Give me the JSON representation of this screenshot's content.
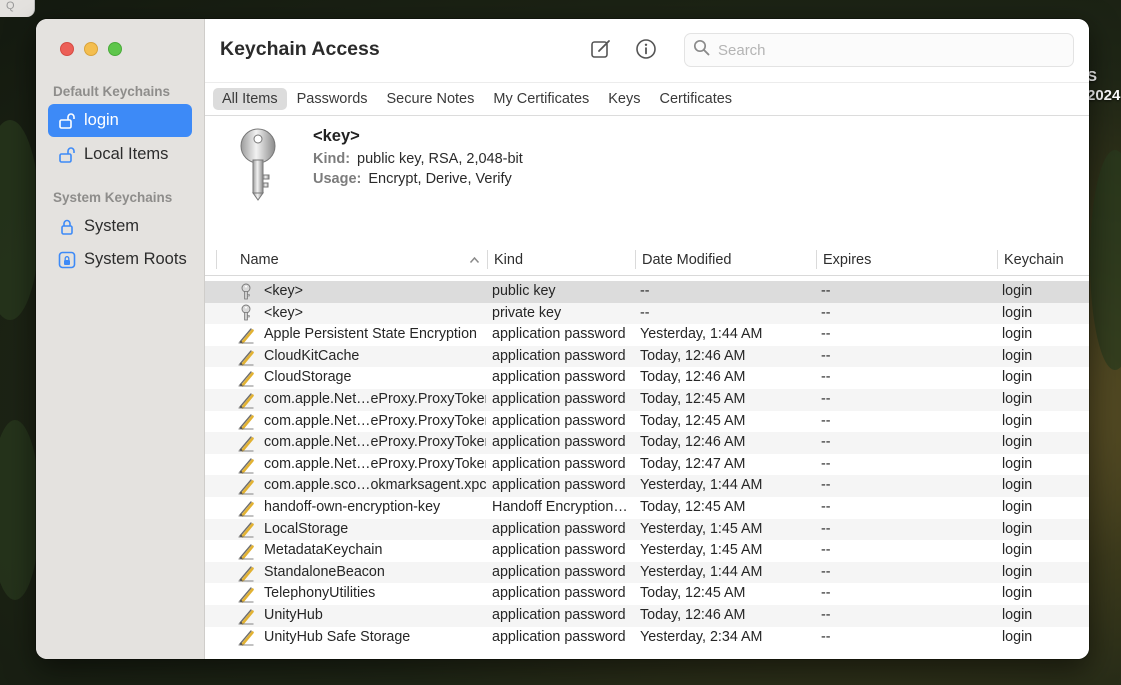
{
  "background": {
    "partial_window_text": "Q",
    "right_text": "S\n2024"
  },
  "window": {
    "app_title": "Keychain Access",
    "search": {
      "placeholder": "Search",
      "value": ""
    },
    "toolbar_icons": [
      "compose-icon",
      "info-icon"
    ]
  },
  "sidebar": {
    "default_section": "Default Keychains",
    "default_items": [
      {
        "label": "login",
        "icon": "unlocked-padlock-icon",
        "selected": true
      },
      {
        "label": "Local Items",
        "icon": "unlocked-padlock-icon",
        "selected": false
      }
    ],
    "system_section": "System Keychains",
    "system_items": [
      {
        "label": "System",
        "icon": "locked-padlock-icon",
        "selected": false
      },
      {
        "label": "System Roots",
        "icon": "cabinet-lock-icon",
        "selected": false
      }
    ]
  },
  "tabs": [
    {
      "label": "All Items",
      "active": true
    },
    {
      "label": "Passwords",
      "active": false
    },
    {
      "label": "Secure Notes",
      "active": false
    },
    {
      "label": "My Certificates",
      "active": false
    },
    {
      "label": "Keys",
      "active": false
    },
    {
      "label": "Certificates",
      "active": false
    }
  ],
  "detail": {
    "name": "<key>",
    "kind_label": "Kind:",
    "kind_value": "public key, RSA, 2,048-bit",
    "usage_label": "Usage:",
    "usage_value": "Encrypt, Derive, Verify"
  },
  "table": {
    "columns": {
      "name": "Name",
      "kind": "Kind",
      "date_modified": "Date Modified",
      "expires": "Expires",
      "keychain": "Keychain"
    },
    "sort_indicator": "chevron-up-icon",
    "rows": [
      {
        "icon": "key-icon",
        "name": "<key>",
        "kind": "public key",
        "date": "--",
        "expires": "--",
        "keychain": "login",
        "selected": true
      },
      {
        "icon": "key-icon",
        "name": "<key>",
        "kind": "private key",
        "date": "--",
        "expires": "--",
        "keychain": "login"
      },
      {
        "icon": "pencil-icon",
        "name": "Apple Persistent State Encryption",
        "kind": "application password",
        "date": "Yesterday, 1:44 AM",
        "expires": "--",
        "keychain": "login"
      },
      {
        "icon": "pencil-icon",
        "name": "CloudKitCache",
        "kind": "application password",
        "date": "Today, 12:46 AM",
        "expires": "--",
        "keychain": "login"
      },
      {
        "icon": "pencil-icon",
        "name": "CloudStorage",
        "kind": "application password",
        "date": "Today, 12:46 AM",
        "expires": "--",
        "keychain": "login"
      },
      {
        "icon": "pencil-icon",
        "name": "com.apple.Net…eProxy.ProxyToken",
        "kind": "application password",
        "date": "Today, 12:45 AM",
        "expires": "--",
        "keychain": "login"
      },
      {
        "icon": "pencil-icon",
        "name": "com.apple.Net…eProxy.ProxyToken",
        "kind": "application password",
        "date": "Today, 12:45 AM",
        "expires": "--",
        "keychain": "login"
      },
      {
        "icon": "pencil-icon",
        "name": "com.apple.Net…eProxy.ProxyToken",
        "kind": "application password",
        "date": "Today, 12:46 AM",
        "expires": "--",
        "keychain": "login"
      },
      {
        "icon": "pencil-icon",
        "name": "com.apple.Net…eProxy.ProxyToken",
        "kind": "application password",
        "date": "Today, 12:47 AM",
        "expires": "--",
        "keychain": "login"
      },
      {
        "icon": "pencil-icon",
        "name": "com.apple.sco…okmarksagent.xpc",
        "kind": "application password",
        "date": "Yesterday, 1:44 AM",
        "expires": "--",
        "keychain": "login"
      },
      {
        "icon": "pencil-icon",
        "name": "handoff-own-encryption-key",
        "kind": "Handoff Encryption…",
        "date": "Today, 12:45 AM",
        "expires": "--",
        "keychain": "login"
      },
      {
        "icon": "pencil-icon",
        "name": "LocalStorage",
        "kind": "application password",
        "date": "Yesterday, 1:45 AM",
        "expires": "--",
        "keychain": "login"
      },
      {
        "icon": "pencil-icon",
        "name": "MetadataKeychain",
        "kind": "application password",
        "date": "Yesterday, 1:45 AM",
        "expires": "--",
        "keychain": "login"
      },
      {
        "icon": "pencil-icon",
        "name": "StandaloneBeacon",
        "kind": "application password",
        "date": "Yesterday, 1:44 AM",
        "expires": "--",
        "keychain": "login"
      },
      {
        "icon": "pencil-icon",
        "name": "TelephonyUtilities",
        "kind": "application password",
        "date": "Today, 12:45 AM",
        "expires": "--",
        "keychain": "login"
      },
      {
        "icon": "pencil-icon",
        "name": "UnityHub",
        "kind": "application password",
        "date": "Today, 12:46 AM",
        "expires": "--",
        "keychain": "login"
      },
      {
        "icon": "pencil-icon",
        "name": "UnityHub Safe Storage",
        "kind": "application password",
        "date": "Yesterday, 2:34 AM",
        "expires": "--",
        "keychain": "login"
      }
    ]
  }
}
